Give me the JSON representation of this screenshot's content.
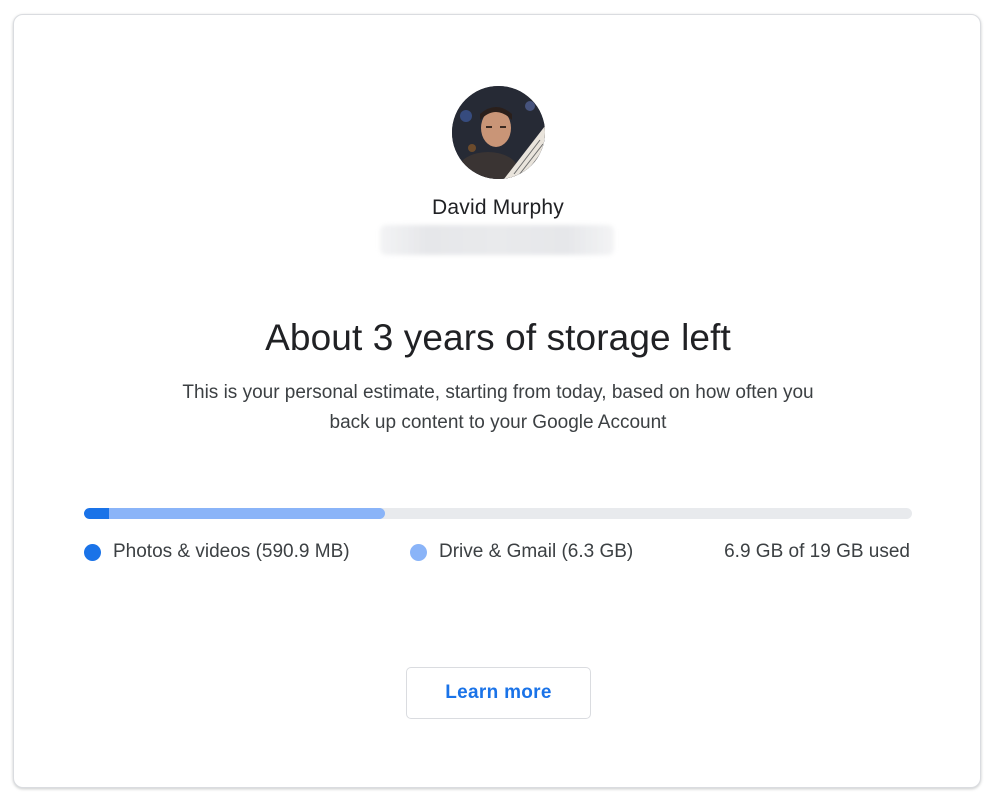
{
  "account": {
    "name": "David Murphy",
    "email": "",
    "avatar_icon": "user-avatar-photo"
  },
  "estimate": {
    "headline": "About 3 years of storage left",
    "description": "This is your personal estimate, starting from today, based on how often you back up content to your Google Account"
  },
  "storage": {
    "used_fraction": 0.363,
    "photos_fraction": 0.03,
    "legend": [
      {
        "label": "Photos & videos (590.9 MB)",
        "color": "#1a73e8"
      },
      {
        "label": "Drive & Gmail (6.3 GB)",
        "color": "#8ab4f8"
      }
    ],
    "total_label": "6.9 GB of 19 GB used",
    "track_color": "#e8eaed"
  },
  "actions": {
    "learn_more_label": "Learn more"
  },
  "colors": {
    "accent": "#1a73e8",
    "accent_light": "#8ab4f8"
  }
}
